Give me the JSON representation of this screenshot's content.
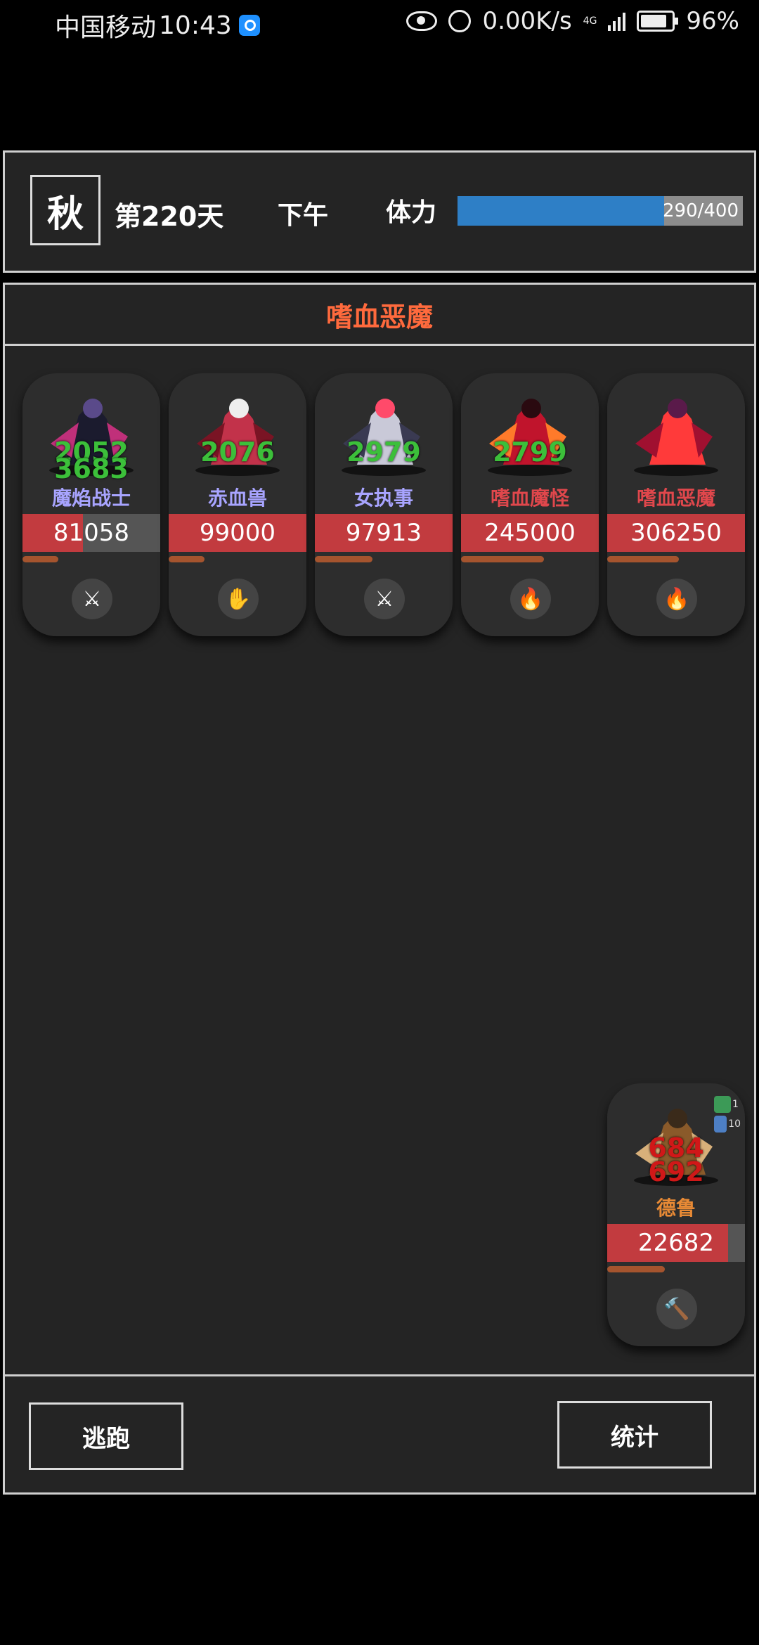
{
  "status_bar": {
    "carrier": "中国移动",
    "time": "10:43",
    "net_speed": "0.00K/s",
    "network": "4G",
    "battery": "96%"
  },
  "header": {
    "season": "秋",
    "day": "第220天",
    "period": "下午",
    "stamina_label": "体力",
    "stamina_text": "290/400",
    "stamina_fraction": 0.725
  },
  "battle": {
    "title": "嗜血恶魔",
    "enemies": [
      {
        "name": "魔焰战士",
        "name_color": "#a8a4ff",
        "hp": "81058",
        "hp_fraction": 0.44,
        "mp_fraction": 0.26,
        "damage": [
          "2052",
          "3683"
        ],
        "skill_icon": "sword-icon",
        "skill_glyph": "⚔"
      },
      {
        "name": "赤血兽",
        "name_color": "#a8a4ff",
        "hp": "99000",
        "hp_fraction": 1.0,
        "mp_fraction": 0.26,
        "damage": [
          "2076"
        ],
        "skill_icon": "claw-icon",
        "skill_glyph": "✋"
      },
      {
        "name": "女执事",
        "name_color": "#a8a4ff",
        "hp": "97913",
        "hp_fraction": 1.0,
        "mp_fraction": 0.42,
        "damage": [
          "2979"
        ],
        "skill_icon": "sword-icon",
        "skill_glyph": "⚔"
      },
      {
        "name": "嗜血魔怪",
        "name_color": "#e0474c",
        "hp": "245000",
        "hp_fraction": 1.0,
        "mp_fraction": 0.6,
        "damage": [
          "2799"
        ],
        "skill_icon": "fire-icon",
        "skill_glyph": "🔥"
      },
      {
        "name": "嗜血恶魔",
        "name_color": "#e0474c",
        "hp": "306250",
        "hp_fraction": 1.0,
        "mp_fraction": 0.52,
        "damage": [],
        "skill_icon": "fire-icon",
        "skill_glyph": "🔥"
      }
    ],
    "player": {
      "name": "德鲁",
      "name_color": "#e88a35",
      "hp": "22682",
      "hp_fraction": 0.88,
      "mp_fraction": 0.42,
      "damage": [
        "684",
        "692"
      ],
      "skill_icon": "hammer-icon",
      "skill_glyph": "🔨",
      "buffs": [
        {
          "icon": "shield-buff-icon",
          "count": "1",
          "color": "#3c9a57"
        },
        {
          "icon": "ice-buff-icon",
          "count": "10",
          "color": "#4d7fc4"
        }
      ]
    }
  },
  "buttons": {
    "flee": "逃跑",
    "stats": "统计"
  }
}
